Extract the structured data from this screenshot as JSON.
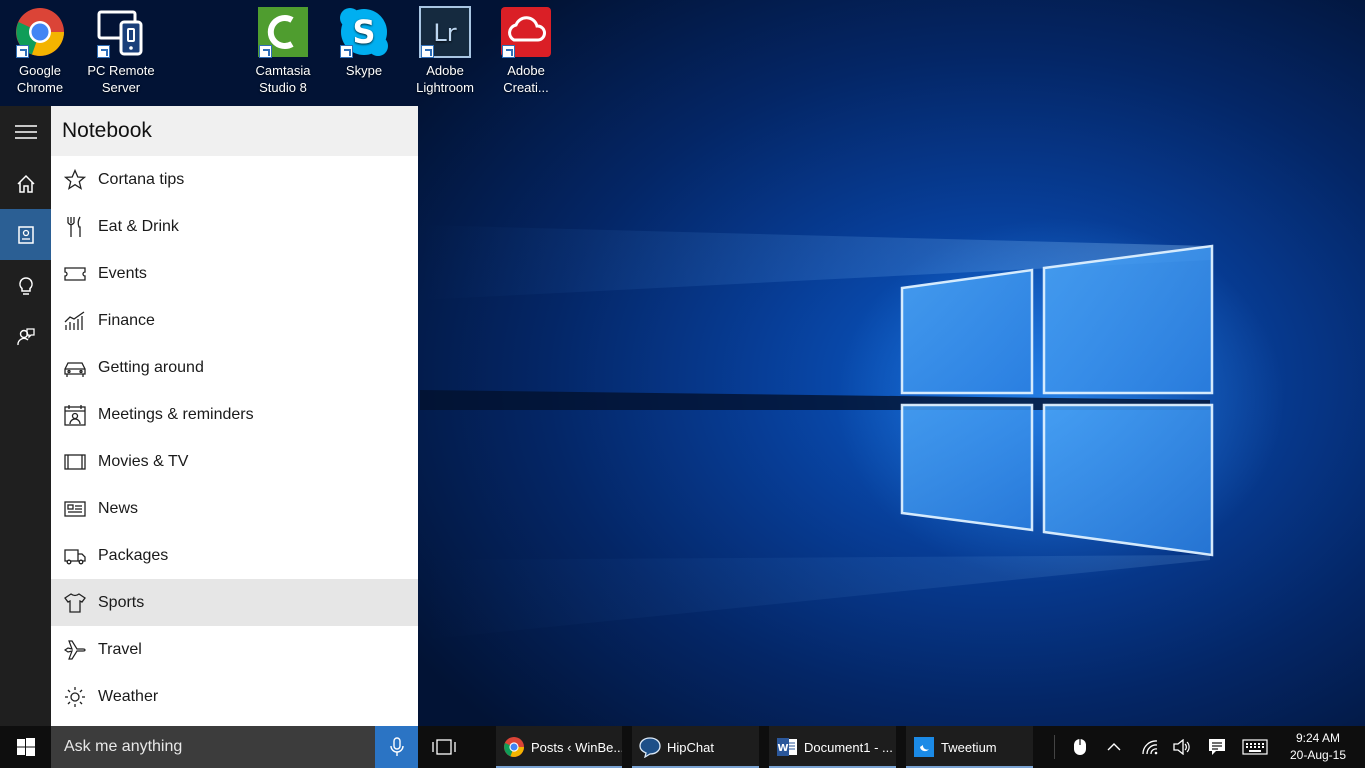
{
  "desktop": {
    "icons": [
      {
        "label_line1": "Google",
        "label_line2": "Chrome",
        "icon": "chrome-icon"
      },
      {
        "label_line1": "PC Remote",
        "label_line2": "Server",
        "icon": "pc-remote-icon"
      },
      {
        "label_line1": "Camtasia",
        "label_line2": "Studio 8",
        "icon": "camtasia-icon"
      },
      {
        "label_line1": "Skype",
        "label_line2": "",
        "icon": "skype-icon"
      },
      {
        "label_line1": "Adobe",
        "label_line2": "Lightroom",
        "icon": "lightroom-icon"
      },
      {
        "label_line1": "Adobe",
        "label_line2": "Creati...",
        "icon": "creative-cloud-icon"
      }
    ]
  },
  "cortana": {
    "rail": [
      {
        "icon": "hamburger-menu-icon"
      },
      {
        "icon": "home-icon"
      },
      {
        "icon": "notebook-icon",
        "active": true
      },
      {
        "icon": "lightbulb-icon"
      },
      {
        "icon": "feedback-icon"
      }
    ],
    "notebook": {
      "title": "Notebook",
      "items": [
        {
          "label": "Cortana tips",
          "icon": "star-icon"
        },
        {
          "label": "Eat & Drink",
          "icon": "fork-knife-icon"
        },
        {
          "label": "Events",
          "icon": "ticket-icon"
        },
        {
          "label": "Finance",
          "icon": "chart-icon"
        },
        {
          "label": "Getting around",
          "icon": "car-icon"
        },
        {
          "label": "Meetings & reminders",
          "icon": "calendar-person-icon"
        },
        {
          "label": "Movies & TV",
          "icon": "film-icon"
        },
        {
          "label": "News",
          "icon": "newspaper-icon"
        },
        {
          "label": "Packages",
          "icon": "truck-icon"
        },
        {
          "label": "Sports",
          "icon": "jersey-icon",
          "selected": true
        },
        {
          "label": "Travel",
          "icon": "airplane-icon"
        },
        {
          "label": "Weather",
          "icon": "sun-icon"
        }
      ]
    }
  },
  "taskbar": {
    "search_placeholder": "Ask me anything",
    "tasks": [
      {
        "label": "Posts ‹ WinBe...",
        "icon": "chrome-icon"
      },
      {
        "label": "HipChat",
        "icon": "hipchat-icon"
      },
      {
        "label": "Document1 - ...",
        "icon": "word-icon"
      },
      {
        "label": "Tweetium",
        "icon": "tweetium-icon"
      }
    ],
    "clock": {
      "time": "9:24 AM",
      "date": "20-Aug-15"
    }
  }
}
